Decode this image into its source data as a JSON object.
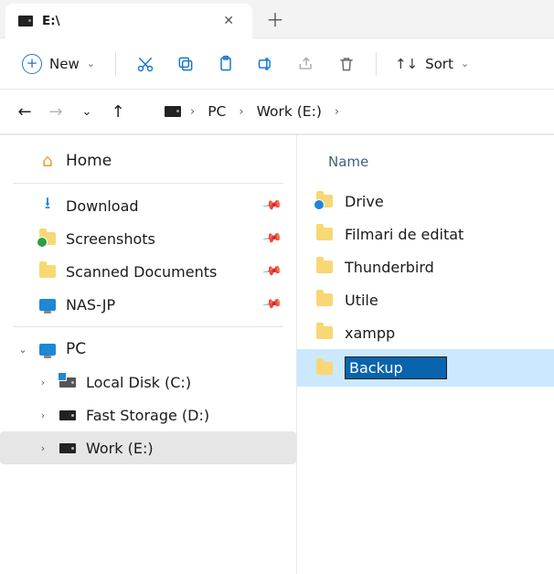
{
  "tab": {
    "title": "E:\\"
  },
  "toolbar": {
    "new_label": "New",
    "sort_label": "Sort"
  },
  "breadcrumbs": {
    "pc": "PC",
    "drive": "Work (E:)"
  },
  "sidebar": {
    "home": "Home",
    "quick": [
      {
        "label": "Download"
      },
      {
        "label": "Screenshots"
      },
      {
        "label": "Scanned Documents"
      },
      {
        "label": "NAS-JP"
      }
    ],
    "pc_label": "PC",
    "drives": [
      {
        "label": "Local Disk (C:)"
      },
      {
        "label": "Fast Storage (D:)"
      },
      {
        "label": "Work (E:)"
      }
    ]
  },
  "content": {
    "column_name": "Name",
    "items": [
      {
        "label": "Drive"
      },
      {
        "label": "Filmari de editat"
      },
      {
        "label": "Thunderbird"
      },
      {
        "label": "Utile"
      },
      {
        "label": "xampp"
      }
    ],
    "rename_value": "Backup"
  }
}
